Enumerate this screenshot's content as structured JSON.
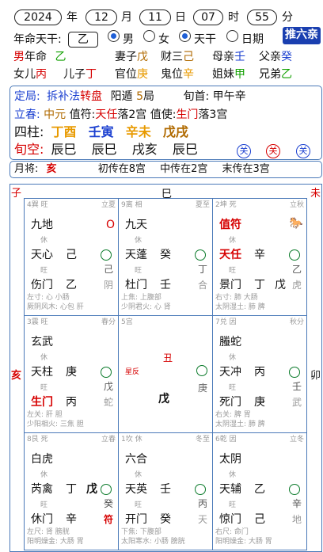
{
  "date": {
    "year": "2024",
    "year_unit": "年",
    "month": "12",
    "month_unit": "月",
    "day": "11",
    "day_unit": "日",
    "hour": "07",
    "hour_unit": "时",
    "minute": "55",
    "minute_unit": "分"
  },
  "options": {
    "stem_label": "年命天干:",
    "stem_value": "乙",
    "male": "男",
    "female": "女",
    "tianpan": "天干",
    "ripan": "日期",
    "submit": "推六亲"
  },
  "relatives": [
    {
      "a": "男",
      "b": "年命",
      "c": "乙"
    },
    {
      "a": "妻子",
      "b": "戊"
    },
    {
      "a": "财三",
      "b": "己"
    },
    {
      "a": "母亲",
      "b": "壬"
    },
    {
      "a": "父亲",
      "b": "癸"
    },
    {
      "a": "女儿",
      "b": "丙"
    },
    {
      "a": "儿子",
      "b": "丁"
    },
    {
      "a": "官位",
      "b": "庚"
    },
    {
      "a": "鬼位",
      "b": "辛"
    },
    {
      "a": "姐妹",
      "b": "甲"
    },
    {
      "a": "兄弟",
      "b": "乙"
    }
  ],
  "info": {
    "line1a": "定局:",
    "line1b": "拆补法",
    "line1c": "转盘",
    "line1d": "阳遁",
    "line1e": "5",
    "line1f": "局",
    "line1g": "旬首:",
    "line1h": "甲午辛",
    "line2a": "立春:",
    "line2b": "中元",
    "line2c": "值符:",
    "line2d": "天任",
    "line2e": "落2宫",
    "line2f": "值使:",
    "line2g": "生门",
    "line2h": "落3宫",
    "pillar_label": "四柱:",
    "p1": "丁酉",
    "p2": "壬寅",
    "p3": "辛未",
    "p4": "戊戌",
    "void_label": "旬空:",
    "v1": "辰巳",
    "v2": "辰巳",
    "v3": "戌亥",
    "v4": "辰巳",
    "guan": "关",
    "jiang_label": "月将:",
    "jiang": "亥",
    "pos1": "初传在8宫",
    "pos2": "中传在2宫",
    "pos3": "末传在3宫"
  },
  "outer": {
    "top": "巳",
    "left": "亥",
    "right": "卯",
    "tl": "子",
    "tr": "未",
    "bl": "",
    "br": ""
  },
  "palaces": [
    {
      "head": "4巽 旺",
      "tag": "立夏",
      "god": "九地",
      "mark": "O",
      "star": "天心",
      "s2": "己",
      "door": "伤门",
      "d2": "乙",
      "extra": "己",
      "corner": "阴",
      "info1": "左寸: 心 小肠",
      "info2": "厥阴风木: 心包 肝"
    },
    {
      "head": "9离 相",
      "tag": "夏至",
      "god": "九天",
      "mark": "",
      "star": "天蓬",
      "s2": "癸",
      "door": "杜门",
      "d2": "壬",
      "extra": "丁",
      "corner": "合",
      "info1": "上焦: 上腹部",
      "info2": "少阴君火: 心 肾"
    },
    {
      "head": "2坤 死",
      "tag": "立秋",
      "god": "值符",
      "mark": "horse",
      "star": "天任",
      "s2": "辛",
      "door": "景门",
      "d2": "丁",
      "d3": "戊",
      "extra": "乙",
      "corner": "虎",
      "info1": "右寸: 肺 大肠",
      "info2": "太阴湿土: 肺 脾"
    },
    {
      "head": "3震 旺",
      "tag": "春分",
      "god": "玄武",
      "mark": "",
      "star": "天柱",
      "s2": "庚",
      "door": "生门",
      "d2": "丙",
      "extra": "戊",
      "corner": "蛇",
      "info1": "左关: 肝 胆",
      "info2": "少阳相火: 三焦 胆"
    },
    {
      "head": "5宫",
      "tag": "",
      "god": "",
      "mark": "",
      "star": "",
      "s2": "",
      "door": "",
      "d2": "戊",
      "extra": "庚",
      "corner": "",
      "info1": "",
      "info2": "",
      "center_top": "丑",
      "center_left": "星反"
    },
    {
      "head": "7兑 因",
      "tag": "秋分",
      "god": "螣蛇",
      "mark": "",
      "star": "天冲",
      "s2": "丙",
      "door": "死门",
      "d2": "庚",
      "extra": "壬",
      "corner": "武",
      "info1": "右关: 脾 胃",
      "info2": "太阴湿土: 肺 脾"
    },
    {
      "head": "8艮 死",
      "tag": "立春",
      "god": "白虎",
      "mark": "",
      "star": "芮禽",
      "s2": "丁",
      "s3": "戊",
      "door": "休门",
      "d2": "辛",
      "extra": "癸",
      "corner": "符",
      "info1": "左尺: 肾 膀胱",
      "info2": "阳明燥金: 大肠 胃"
    },
    {
      "head": "1坎 休",
      "tag": "冬至",
      "god": "六合",
      "mark": "",
      "star": "天英",
      "s2": "壬",
      "door": "开门",
      "d2": "癸",
      "extra": "丙",
      "corner": "天",
      "info1": "下焦: 下腹部",
      "info2": "太阳寒水: 小肠 膀胱"
    },
    {
      "head": "6乾 因",
      "tag": "立冬",
      "god": "太阴",
      "mark": "",
      "star": "天辅",
      "s2": "乙",
      "door": "惊门",
      "d2": "己",
      "extra": "辛",
      "corner": "地",
      "info1": "右尺: 命门",
      "info2": "阳明燥金: 大肠 胃"
    }
  ],
  "colors": {
    "accent": "#1a3fb0",
    "border": "#4a79b8",
    "red": "#d60000",
    "green": "#11a000"
  }
}
